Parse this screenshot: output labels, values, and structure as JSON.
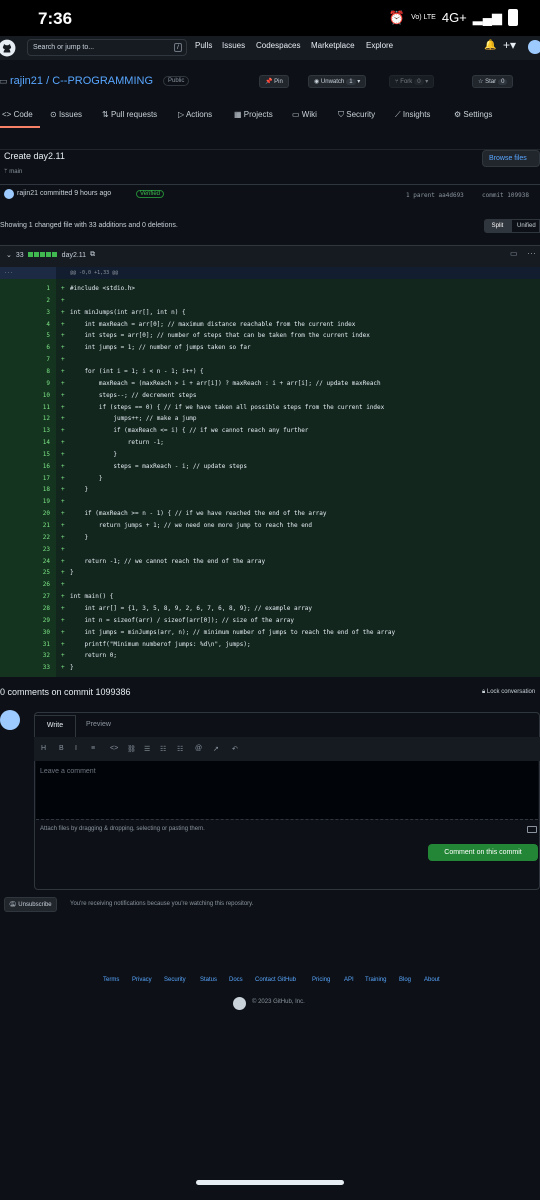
{
  "status_bar": {
    "time": "7:36",
    "network": "4G+",
    "volte": "Vo) LTE"
  },
  "top_nav": {
    "search_placeholder": "Search or jump to...",
    "search_key": "/",
    "links": [
      "Pulls",
      "Issues",
      "Codespaces",
      "Marketplace",
      "Explore"
    ]
  },
  "repo": {
    "owner": "rajin21",
    "name": "C--PROGRAMMING",
    "full_title": "rajin21 / C--PROGRAMMING",
    "visibility": "Public",
    "pin": "Pin",
    "unwatch": "Unwatch",
    "unwatch_count": "1",
    "fork": "Fork",
    "fork_count": "0",
    "star": "Star",
    "star_count": "0"
  },
  "tabs": [
    "Code",
    "Issues",
    "Pull requests",
    "Actions",
    "Projects",
    "Wiki",
    "Security",
    "Insights",
    "Settings"
  ],
  "commit": {
    "title": "Create day2.11",
    "branch": "main",
    "browse_files": "Browse files",
    "committer_line": "rajin21 committed 9 hours ago",
    "verified": "Verified",
    "parent": "1 parent  aa4d693",
    "commit_id": "commit  109938"
  },
  "diff": {
    "summary": "Showing 1 changed file with 33 additions and 0 deletions.",
    "split": "Split",
    "unified": "Unified",
    "file_additions": "33",
    "file_name": "day2.11",
    "hunk_gutter": "...",
    "hunk": "@@ -0,0 +1,33 @@",
    "lines": [
      "#include <stdio.h>",
      "",
      "int minJumps(int arr[], int n) {",
      "    int maxReach = arr[0]; // maximum distance reachable from the current index",
      "    int steps = arr[0]; // number of steps that can be taken from the current index",
      "    int jumps = 1; // number of jumps taken so far",
      "",
      "    for (int i = 1; i < n - 1; i++) {",
      "        maxReach = (maxReach > i + arr[i]) ? maxReach : i + arr[i]; // update maxReach",
      "        steps--; // decrement steps",
      "        if (steps == 0) { // if we have taken all possible steps from the current index",
      "            jumps++; // make a jump",
      "            if (maxReach <= i) { // if we cannot reach any further",
      "                return -1;",
      "            }",
      "            steps = maxReach - i; // update steps",
      "        }",
      "    }",
      "",
      "    if (maxReach >= n - 1) { // if we have reached the end of the array",
      "        return jumps + 1; // we need one more jump to reach the end",
      "    }",
      "",
      "    return -1; // we cannot reach the end of the array",
      "}",
      "",
      "int main() {",
      "    int arr[] = {1, 3, 5, 8, 9, 2, 6, 7, 6, 8, 9}; // example array",
      "    int n = sizeof(arr) / sizeof(arr[0]); // size of the array",
      "    int jumps = minJumps(arr, n); // minimum number of jumps to reach the end of the array",
      "    printf(\"Minimum numberof jumps: %d\\n\", jumps);",
      "    return 0;",
      "}"
    ]
  },
  "comments": {
    "title": "0 comments on commit  1099386",
    "lock": "Lock conversation",
    "write": "Write",
    "preview": "Preview",
    "toolbar": [
      "H",
      "B",
      "I",
      "≡",
      "<>",
      "⛓",
      "☰",
      "☷",
      "☷",
      "@",
      "↗",
      "↶"
    ],
    "placeholder": "Leave a comment",
    "attach": "Attach files by dragging & dropping, selecting or pasting them.",
    "submit": "Comment on this commit",
    "unsubscribe": "Unsubscribe",
    "notification": "You're receiving notifications because you're watching this repository."
  },
  "footer": {
    "links": [
      "Terms",
      "Privacy",
      "Security",
      "Status",
      "Docs",
      "Contact GitHub",
      "Pricing",
      "API",
      "Training",
      "Blog",
      "About"
    ],
    "copyright": "© 2023 GitHub, Inc."
  },
  "colors": {
    "accent": "#58a6ff",
    "added_bg": "#12261e",
    "added_text": "#7ee787",
    "green_button": "#238636"
  }
}
